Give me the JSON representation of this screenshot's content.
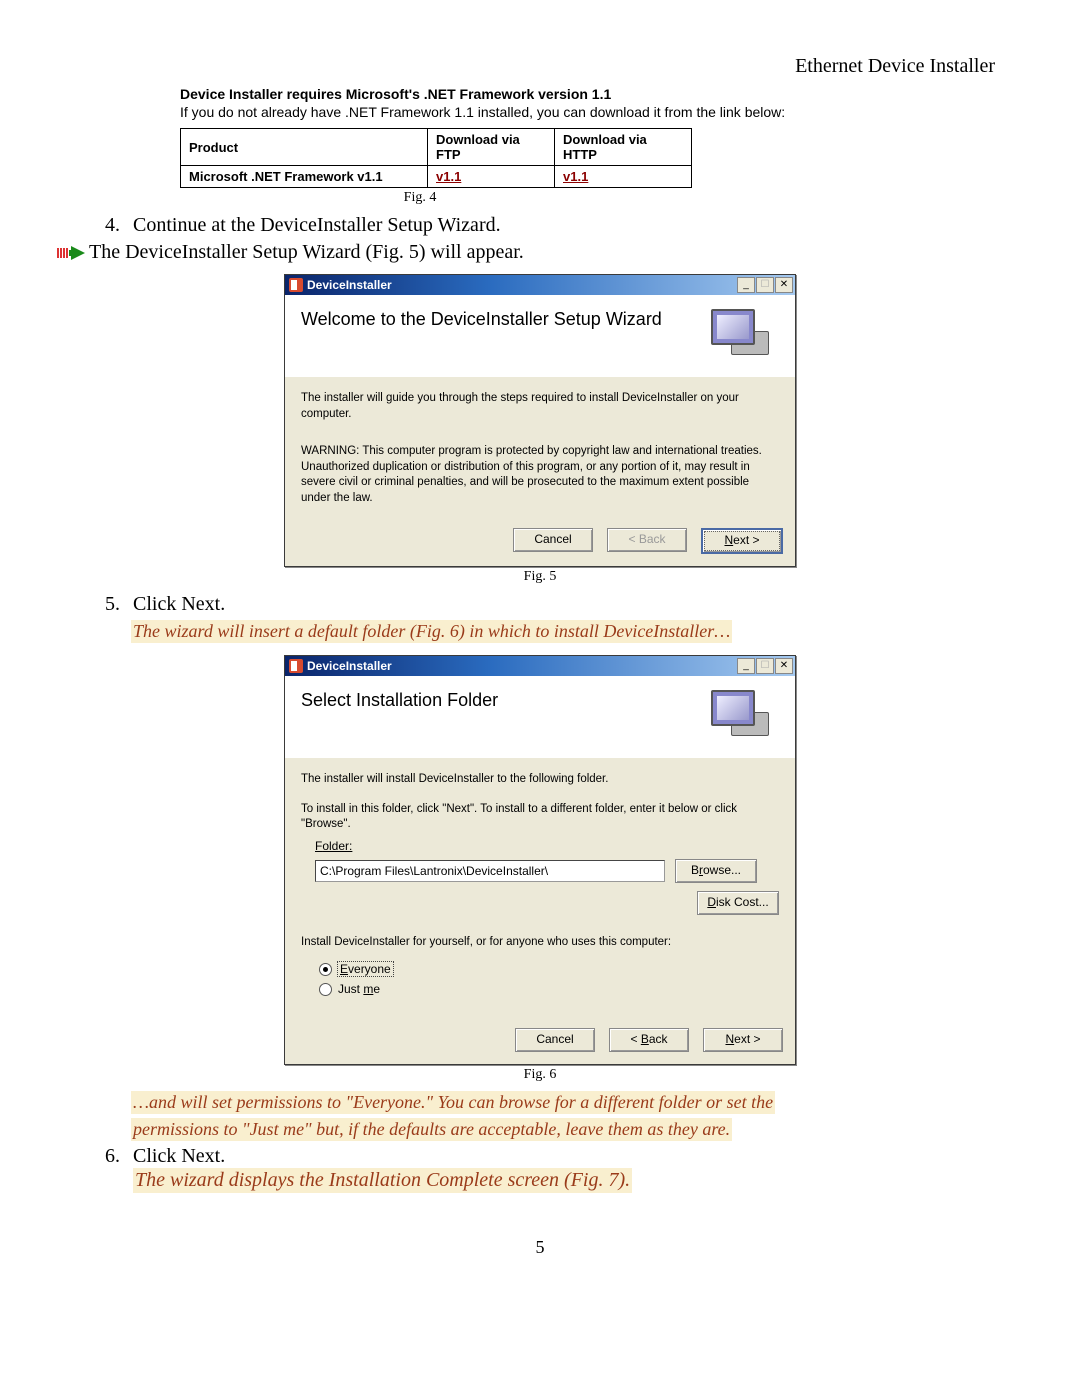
{
  "header": {
    "title": "Ethernet Device Installer"
  },
  "intro": {
    "bold": "Device Installer requires Microsoft's .NET Framework version 1.1",
    "plain": "If you do not already have .NET Framework 1.1 installed, you can download it from the link below:"
  },
  "dl_table": {
    "h1": "Product",
    "h2": "Download via FTP",
    "h3": "Download via HTTP",
    "product": "Microsoft .NET Framework v1.1",
    "ftp": "v1.1",
    "http": "v1.1"
  },
  "fig4": "Fig. 4",
  "step4": {
    "text": "Continue at the DeviceInstaller Setup Wizard.",
    "arrow": "The DeviceInstaller Setup Wizard (Fig. 5) will appear."
  },
  "dialog1": {
    "title": "DeviceInstaller",
    "heading": "Welcome to the DeviceInstaller Setup Wizard",
    "p1": "The installer will guide you through the steps required to install DeviceInstaller on your computer.",
    "p2": "WARNING: This computer program is protected by copyright law and international treaties. Unauthorized duplication or distribution of this program, or any portion of it, may result in severe civil or criminal penalties, and will be prosecuted to the maximum extent possible under the law.",
    "cancel": "Cancel",
    "back": "< Back",
    "next": "Next >"
  },
  "fig5": "Fig. 5",
  "step5": {
    "text": "Click Next.",
    "highlight": "The wizard will insert a default folder (Fig. 6) in which to install DeviceInstaller…"
  },
  "dialog2": {
    "title": "DeviceInstaller",
    "heading": "Select Installation Folder",
    "p1": "The installer will install DeviceInstaller to the following folder.",
    "p2": "To install in this folder, click \"Next\". To install to a different folder, enter it below or click \"Browse\".",
    "folder_label": "Folder:",
    "folder_value": "C:\\Program Files\\Lantronix\\DeviceInstaller\\",
    "browse": "Browse...",
    "diskcost": "Disk Cost...",
    "install_for": "Install DeviceInstaller for yourself, or for anyone who uses this computer:",
    "everyone": "Everyone",
    "justme": "Just me",
    "cancel": "Cancel",
    "back": "< Back",
    "next": "Next >"
  },
  "fig6": "Fig. 6",
  "step6": {
    "highlight1": "…and will set permissions to \"Everyone.\" You can browse for a different folder or set the",
    "highlight2": "permissions to \"Just me\" but, if the defaults are acceptable, leave them as they are.",
    "text": "Click Next.",
    "highlight3": "The wizard displays the Installation Complete screen (Fig. 7)."
  },
  "page_number": "5"
}
